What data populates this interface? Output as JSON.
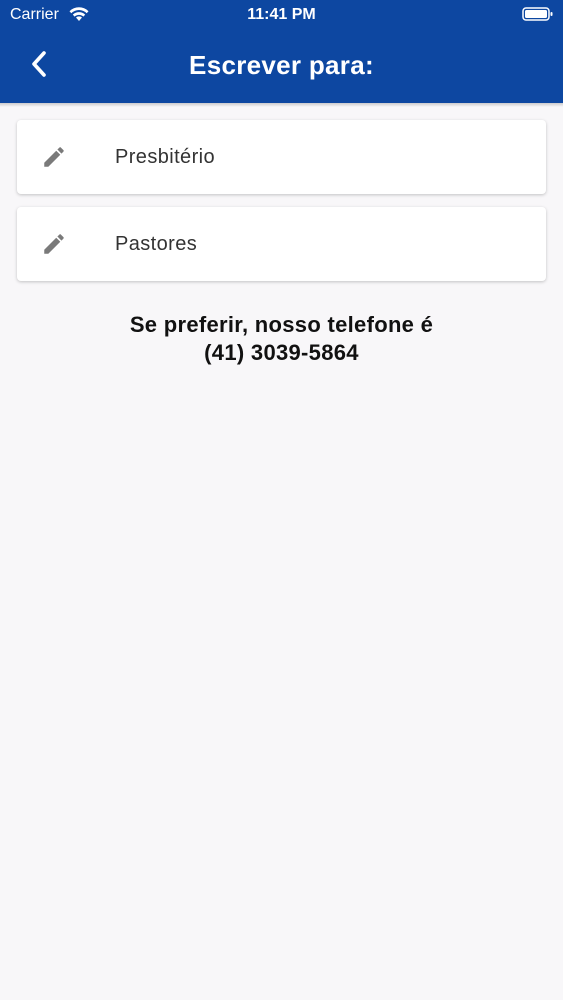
{
  "status_bar": {
    "carrier": "Carrier",
    "time": "11:41 PM",
    "wifi_icon": "wifi-icon",
    "battery_icon": "battery-icon"
  },
  "header": {
    "title": "Escrever para:",
    "back_icon": "chevron-left-icon",
    "background_color": "#0d47a1"
  },
  "options": [
    {
      "label": "Presbitério",
      "icon": "pencil-icon"
    },
    {
      "label": "Pastores",
      "icon": "pencil-icon"
    }
  ],
  "contact": {
    "line1": "Se preferir, nosso telefone é",
    "line2": "(41) 3039-5864"
  }
}
